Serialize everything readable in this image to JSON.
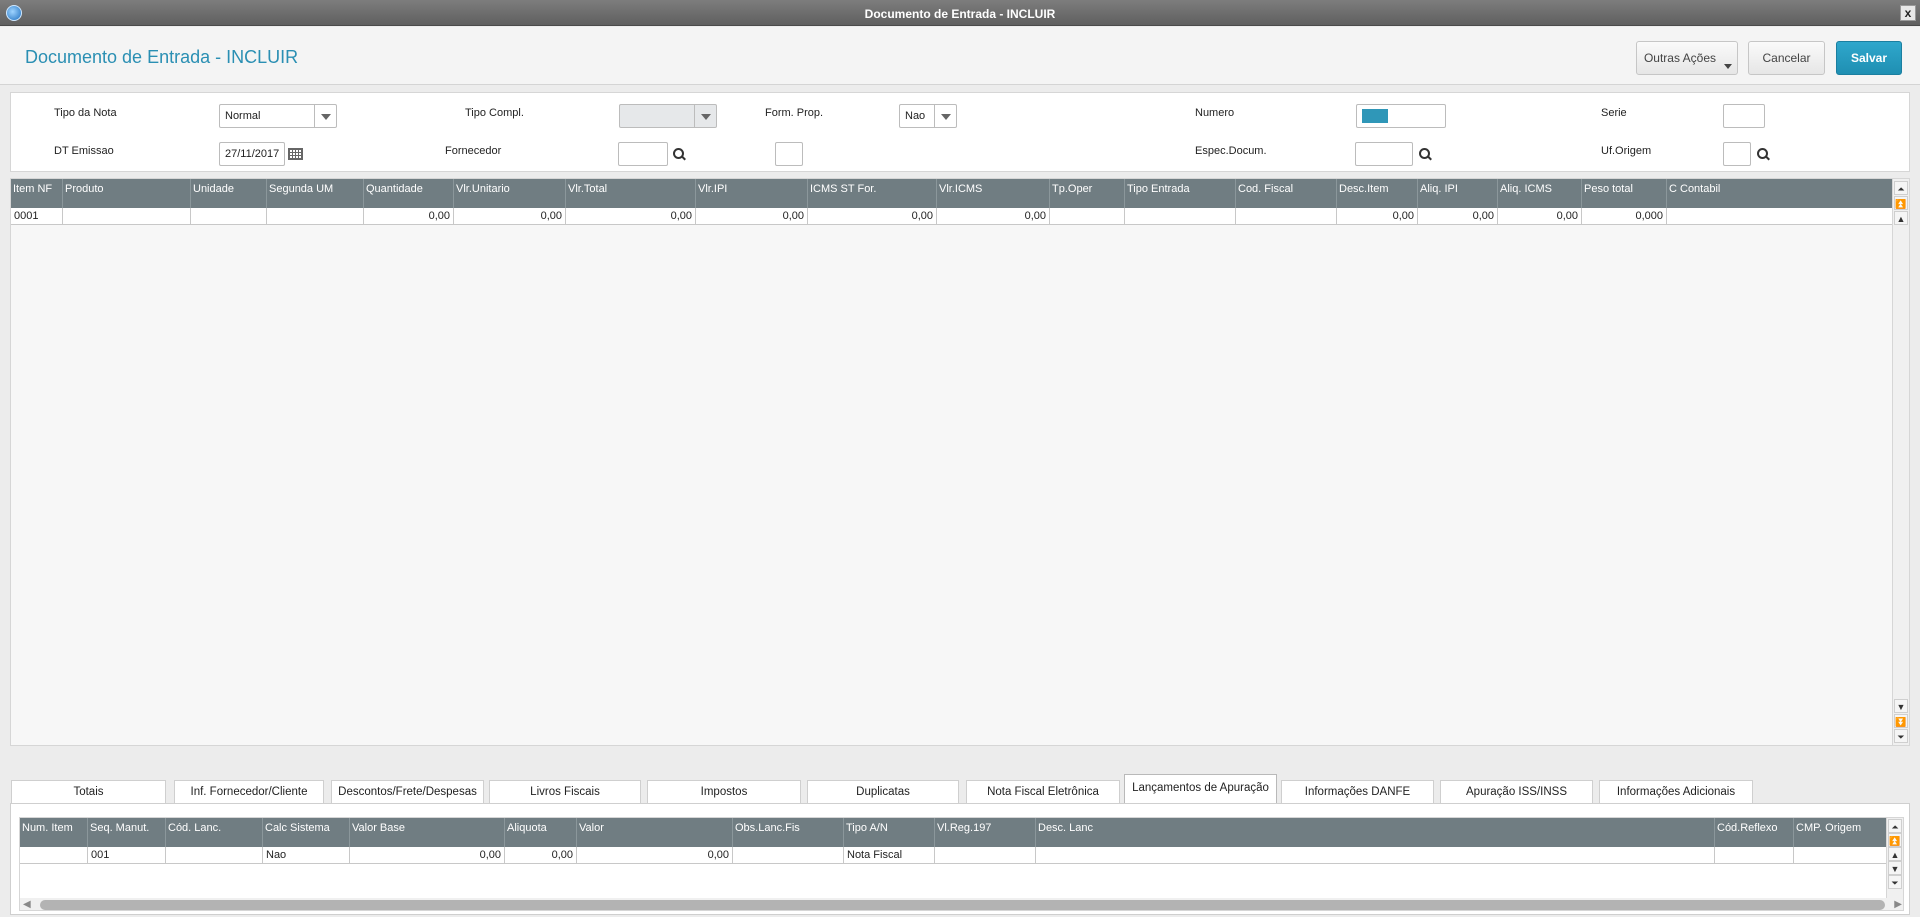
{
  "window": {
    "title": "Documento de Entrada - INCLUIR",
    "close_label": "x"
  },
  "header": {
    "title": "Documento de Entrada - INCLUIR",
    "buttons": {
      "outras_acoes": "Outras Ações",
      "cancelar": "Cancelar",
      "salvar": "Salvar"
    }
  },
  "form": {
    "tipo_nota": {
      "label": "Tipo da Nota",
      "value": "Normal"
    },
    "tipo_compl": {
      "label": "Tipo Compl.",
      "value": ""
    },
    "form_prop": {
      "label": "Form. Prop.",
      "value": "Nao"
    },
    "numero": {
      "label": "Numero",
      "value": ""
    },
    "serie": {
      "label": "Serie",
      "value": ""
    },
    "dt_emissao": {
      "label": "DT Emissao",
      "value": "27/11/2017"
    },
    "fornecedor": {
      "label": "Fornecedor",
      "value": "",
      "loja": ""
    },
    "espec_docum": {
      "label": "Espec.Docum.",
      "value": ""
    },
    "uf_origem": {
      "label": "Uf.Origem",
      "value": ""
    }
  },
  "items_grid": {
    "columns": [
      "Item NF",
      "Produto",
      "Unidade",
      "Segunda UM",
      "Quantidade",
      "Vlr.Unitario",
      "Vlr.Total",
      "Vlr.IPI",
      "ICMS ST For.",
      "Vlr.ICMS",
      "Tp.Oper",
      "Tipo Entrada",
      "Cod. Fiscal",
      "Desc.Item",
      "Aliq. IPI",
      "Aliq. ICMS",
      "Peso total",
      "C Contabil"
    ],
    "rows": [
      [
        "0001",
        "",
        "",
        "",
        "0,00",
        "0,00",
        "0,00",
        "0,00",
        "0,00",
        "0,00",
        "",
        "",
        "",
        "0,00",
        "0,00",
        "0,00",
        "0,000",
        ""
      ]
    ]
  },
  "tabs": [
    {
      "label": "Totais"
    },
    {
      "label": "Inf. Fornecedor/Cliente"
    },
    {
      "label": "Descontos/Frete/Despesas"
    },
    {
      "label": "Livros Fiscais"
    },
    {
      "label": "Impostos"
    },
    {
      "label": "Duplicatas"
    },
    {
      "label": "Nota Fiscal Eletrônica"
    },
    {
      "label": "Lançamentos de Apuração"
    },
    {
      "label": "Informações DANFE"
    },
    {
      "label": "Apuração ISS/INSS"
    },
    {
      "label": "Informações Adicionais"
    }
  ],
  "active_tab": "Lançamentos de Apuração",
  "apuracao_grid": {
    "columns": [
      "Num. Item",
      "Seq. Manut.",
      "Cód. Lanc.",
      "Calc Sistema",
      "Valor Base",
      "Aliquota",
      "Valor",
      "Obs.Lanc.Fis",
      "Tipo A/N",
      "Vl.Reg.197",
      "Desc. Lanc",
      "Cód.Reflexo",
      "CMP. Origem"
    ],
    "rows": [
      [
        "",
        "001",
        "",
        "Nao",
        "0,00",
        "0,00",
        "0,00",
        "",
        "Nota Fiscal",
        "",
        "",
        "",
        ""
      ]
    ]
  },
  "colors": {
    "accent": "#2a8fb3",
    "save_button": "#1f9bc2",
    "grid_header": "#707d82"
  }
}
